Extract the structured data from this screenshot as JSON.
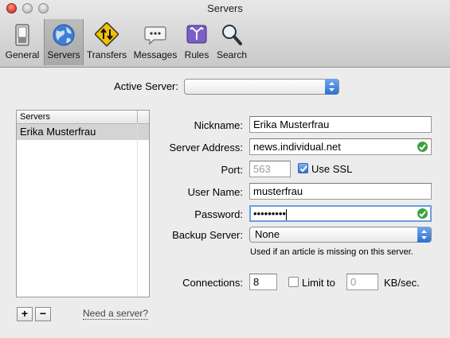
{
  "window": {
    "title": "Servers"
  },
  "toolbar": {
    "items": [
      {
        "label": "General",
        "icon": "switch-icon"
      },
      {
        "label": "Servers",
        "icon": "globe-icon"
      },
      {
        "label": "Transfers",
        "icon": "transfer-sign-icon"
      },
      {
        "label": "Messages",
        "icon": "speech-bubble-icon"
      },
      {
        "label": "Rules",
        "icon": "rules-icon"
      },
      {
        "label": "Search",
        "icon": "magnifier-icon"
      }
    ],
    "selected": "Servers"
  },
  "active_server": {
    "label": "Active Server:",
    "value": ""
  },
  "server_list": {
    "header": "Servers",
    "items": [
      "Erika Musterfrau"
    ]
  },
  "form": {
    "nickname": {
      "label": "Nickname:",
      "value": "Erika Musterfrau"
    },
    "server_address": {
      "label": "Server Address:",
      "value": "news.individual.net",
      "valid": true
    },
    "port": {
      "label": "Port:",
      "value": "563"
    },
    "use_ssl": {
      "label": "Use SSL",
      "checked": true
    },
    "user_name": {
      "label": "User Name:",
      "value": "musterfrau"
    },
    "password": {
      "label": "Password:",
      "value": "•••••••••",
      "valid": true
    },
    "backup_server": {
      "label": "Backup Server:",
      "value": "None"
    },
    "backup_hint": "Used if an article is missing on this server.",
    "connections": {
      "label": "Connections:",
      "value": "8"
    },
    "limit": {
      "label": "Limit to",
      "checked": false,
      "value": "0",
      "unit": "KB/sec."
    }
  },
  "footer": {
    "add_label": "+",
    "remove_label": "−",
    "need_server_link": "Need a server?"
  },
  "colors": {
    "accent": "#3574d4",
    "valid_green": "#3ba33b",
    "focus_ring": "#6a9fe0"
  }
}
